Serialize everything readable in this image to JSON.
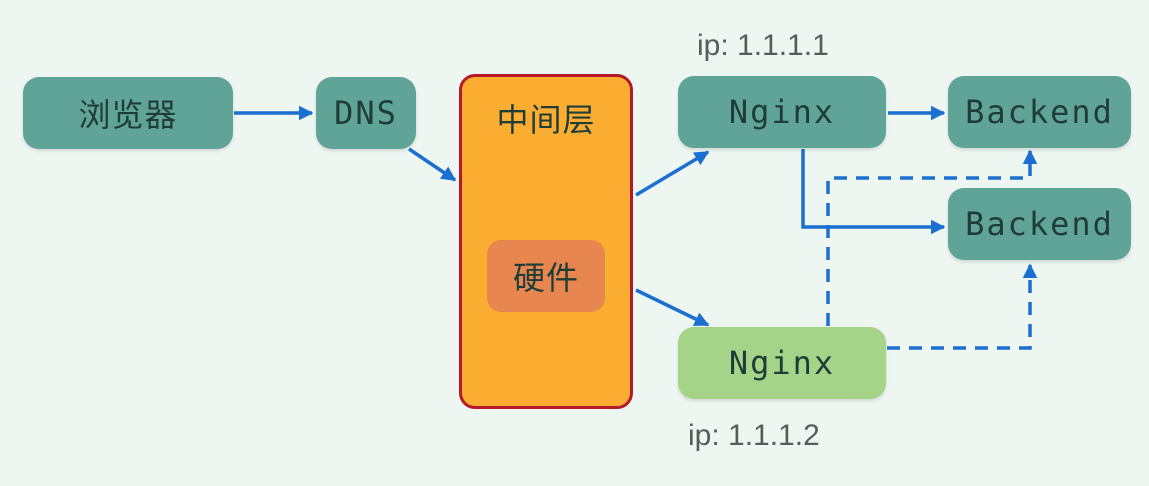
{
  "nodes": {
    "browser": "浏览器",
    "dns": "DNS",
    "middle_layer": "中间层",
    "hardware": "硬件",
    "nginx_primary": "Nginx",
    "nginx_secondary": "Nginx",
    "backend_top": "Backend",
    "backend_bottom": "Backend"
  },
  "ip_labels": {
    "nginx_primary": "ip: 1.1.1.1",
    "nginx_secondary": "ip: 1.1.1.2"
  },
  "colors": {
    "background": "#eef6f2",
    "node_teal": "#5fa497",
    "node_standby_green": "#a5d488",
    "middle_layer_fill": "#fbad32",
    "middle_layer_border": "#b5192a",
    "hardware_fill": "#e7864f",
    "arrow_blue": "#1a6fd0"
  }
}
